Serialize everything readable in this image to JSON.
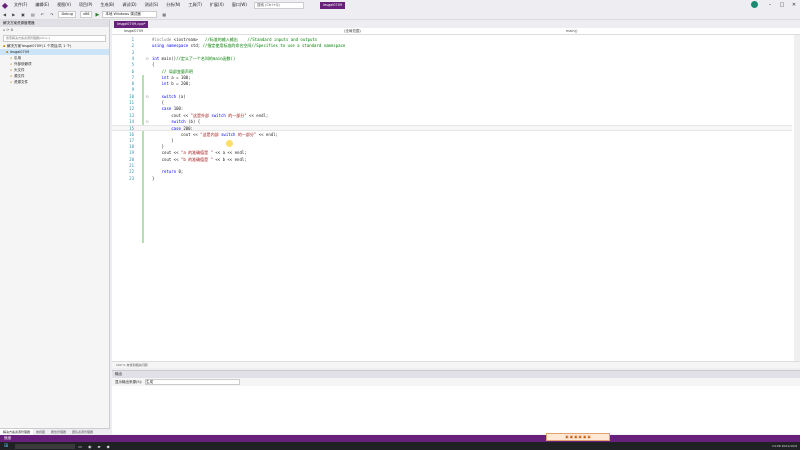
{
  "menubar": {
    "items": [
      "文件(F)",
      "编辑(E)",
      "视图(V)",
      "项目(P)",
      "生成(B)",
      "调试(D)",
      "测试(S)",
      "分析(N)",
      "工具(T)",
      "扩展(X)",
      "窗口(W)",
      "帮助(H)"
    ],
    "search_placeholder": "搜索 (Ctrl+Q)",
    "project_name": "lesgal0709"
  },
  "toolbar": {
    "config": "Debug",
    "platform": "x86",
    "run_label": "本地 Windows 调试器",
    "live_share": "Live Share"
  },
  "sidebar": {
    "title": "解决方案资源管理器",
    "search_placeholder": "搜索解决方案资源管理器(Ctrl+;)",
    "tree": [
      "解决方案'lesgal0709'(1 个项目/共 1 个)",
      "lesgal0709",
      "引用",
      "外部依赖项",
      "头文件",
      "源文件",
      "资源文件"
    ],
    "tabs": [
      "解决方案资源管理器",
      "类视图",
      "属性管理器",
      "团队资源管理器"
    ]
  },
  "editor": {
    "tab": "lesgal0709.cpp*",
    "nav_project": "lesgal0709",
    "nav_scope": "(全局范围)",
    "nav_func": "main()",
    "lines": [
      {
        "n": "1",
        "code": "#include <iostream>   //标准的输入输出    //Standard inputs and outputs"
      },
      {
        "n": "2",
        "code": "using namespace std; //指定使用标准的命名空间//Specifies to use a standard namespace"
      },
      {
        "n": "3",
        "code": ""
      },
      {
        "n": "4",
        "code": "int main()//定义了一个名叫的main函数()"
      },
      {
        "n": "5",
        "code": "{"
      },
      {
        "n": "6",
        "code": "    // 局部变量声明"
      },
      {
        "n": "7",
        "code": "    int a = 100;"
      },
      {
        "n": "8",
        "code": "    int b = 200;"
      },
      {
        "n": "9",
        "code": ""
      },
      {
        "n": "10",
        "code": "    switch (a)"
      },
      {
        "n": "11",
        "code": "    {"
      },
      {
        "n": "12",
        "code": "    case 100:"
      },
      {
        "n": "13",
        "code": "        cout << \"这是外部 switch 的一部分\" << endl;"
      },
      {
        "n": "14",
        "code": "        switch (b) {"
      },
      {
        "n": "15",
        "code": "        case 200:"
      },
      {
        "n": "16",
        "code": "            cout << \"这是内部 switch 的一部分\" << endl;"
      },
      {
        "n": "17",
        "code": "        }"
      },
      {
        "n": "18",
        "code": "    }"
      },
      {
        "n": "19",
        "code": "    cout << \"a 的准确值是 \" << a << endl;"
      },
      {
        "n": "20",
        "code": "    cout << \"b 的准确值是 \" << b << endl;"
      },
      {
        "n": "21",
        "code": ""
      },
      {
        "n": "22",
        "code": "    return 0;"
      },
      {
        "n": "23",
        "code": "}"
      }
    ],
    "status": "100 %   未找到相关问题"
  },
  "output": {
    "title": "输出",
    "show_label": "显示输出来源(S):",
    "source_value": "生成"
  },
  "statusbar": {
    "text": "就绪"
  },
  "taskbar": {
    "time": "14:08 2021/10/9"
  }
}
